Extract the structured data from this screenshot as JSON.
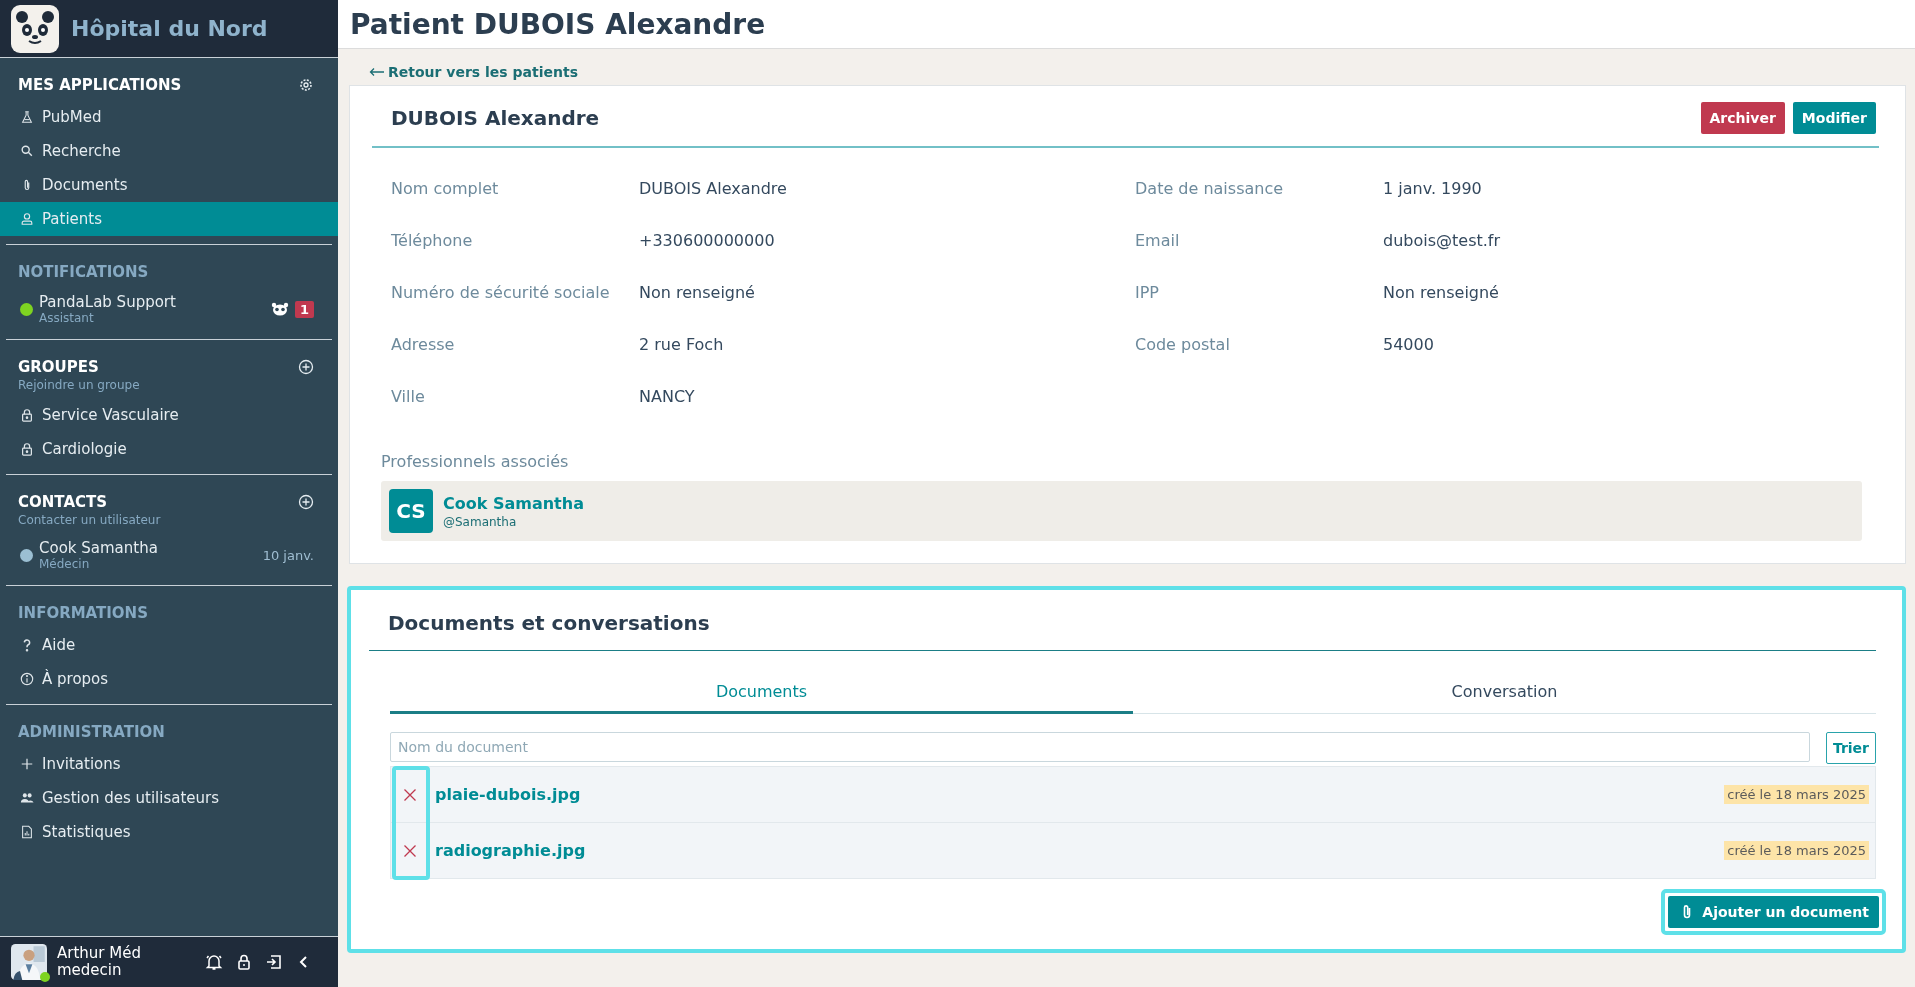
{
  "sidebar": {
    "brand": "Hôpital du Nord",
    "sections": [
      {
        "title": "MES APPLICATIONS",
        "bright": true,
        "items": [
          {
            "kind": "link",
            "label": "PubMed",
            "selected": false
          },
          {
            "kind": "link",
            "label": "Recherche",
            "selected": false
          },
          {
            "kind": "link",
            "label": "Documents",
            "selected": false
          },
          {
            "kind": "link",
            "label": "Patients",
            "selected": true
          }
        ]
      },
      {
        "title": "NOTIFICATIONS",
        "bright": false,
        "items": [
          {
            "kind": "contact",
            "name": "PandaLab Support",
            "role": "Assistant",
            "color": "#7ed321",
            "count": "1"
          }
        ]
      },
      {
        "title": "GROUPES",
        "bright": true,
        "subtitle": "Rejoindre un groupe",
        "items": [
          {
            "kind": "link",
            "label": "Service Vasculaire",
            "selected": false
          },
          {
            "kind": "link",
            "label": "Cardiologie",
            "selected": false
          }
        ]
      },
      {
        "title": "CONTACTS",
        "bright": true,
        "subtitle": "Contacter un utilisateur",
        "items": [
          {
            "kind": "contact",
            "name": "Cook Samantha",
            "role": "Médecin",
            "color": "#9bbfd3",
            "date": "10 janv."
          }
        ]
      },
      {
        "title": "INFORMATIONS",
        "bright": false,
        "items": [
          {
            "kind": "link",
            "label": "Aide",
            "selected": false
          },
          {
            "kind": "link",
            "label": "À propos",
            "selected": false
          }
        ]
      },
      {
        "title": "ADMINISTRATION",
        "bright": false,
        "items": [
          {
            "kind": "link",
            "label": "Invitations",
            "selected": false
          },
          {
            "kind": "link",
            "label": "Gestion des utilisateurs",
            "selected": false
          },
          {
            "kind": "link",
            "label": "Statistiques",
            "selected": false
          }
        ]
      }
    ],
    "user": {
      "name": "Arthur Méd",
      "role": "medecin",
      "online": true
    }
  },
  "page_title": "Patient DUBOIS Alexandre",
  "back_link": "Retour vers les patients",
  "patient": {
    "name": "DUBOIS Alexandre",
    "buttons": [
      {
        "label": "Archiver",
        "kind": "danger"
      },
      {
        "label": "Modifier",
        "kind": "primary"
      }
    ],
    "fields": [
      {
        "label": "Nom complet",
        "value": "DUBOIS Alexandre"
      },
      {
        "label": "Date de naissance",
        "value": "1 janv. 1990"
      },
      {
        "label": "Téléphone",
        "value": "+330600000000"
      },
      {
        "label": "Email",
        "value": "dubois@test.fr"
      },
      {
        "label": "Numéro de sécurité sociale",
        "value": "Non renseigné"
      },
      {
        "label": "IPP",
        "value": "Non renseigné"
      },
      {
        "label": "Adresse",
        "value": "2 rue Foch"
      },
      {
        "label": "Code postal",
        "value": "54000"
      },
      {
        "label": "Ville",
        "value": "NANCY"
      }
    ],
    "professionals": {
      "title": "Professionnels associés",
      "items": [
        {
          "initials": "CS",
          "name": "Cook Samantha",
          "handle": "@Samantha"
        }
      ]
    }
  },
  "documents": {
    "title": "Documents et conversations",
    "highlighted": true,
    "tabs": [
      {
        "label": "Documents",
        "selected": true
      },
      {
        "label": "Conversation",
        "selected": false
      }
    ],
    "search": {
      "placeholder": "Nom du document"
    },
    "sort_button": "Trier",
    "delete_column_highlighted": true,
    "files": [
      {
        "name": "plaie-dubois.jpg",
        "date": "créé le 18 mars 2025"
      },
      {
        "name": "radiographie.jpg",
        "date": "créé le 18 mars 2025"
      }
    ],
    "add_button": {
      "label": "Ajouter un document",
      "highlighted": true
    }
  }
}
